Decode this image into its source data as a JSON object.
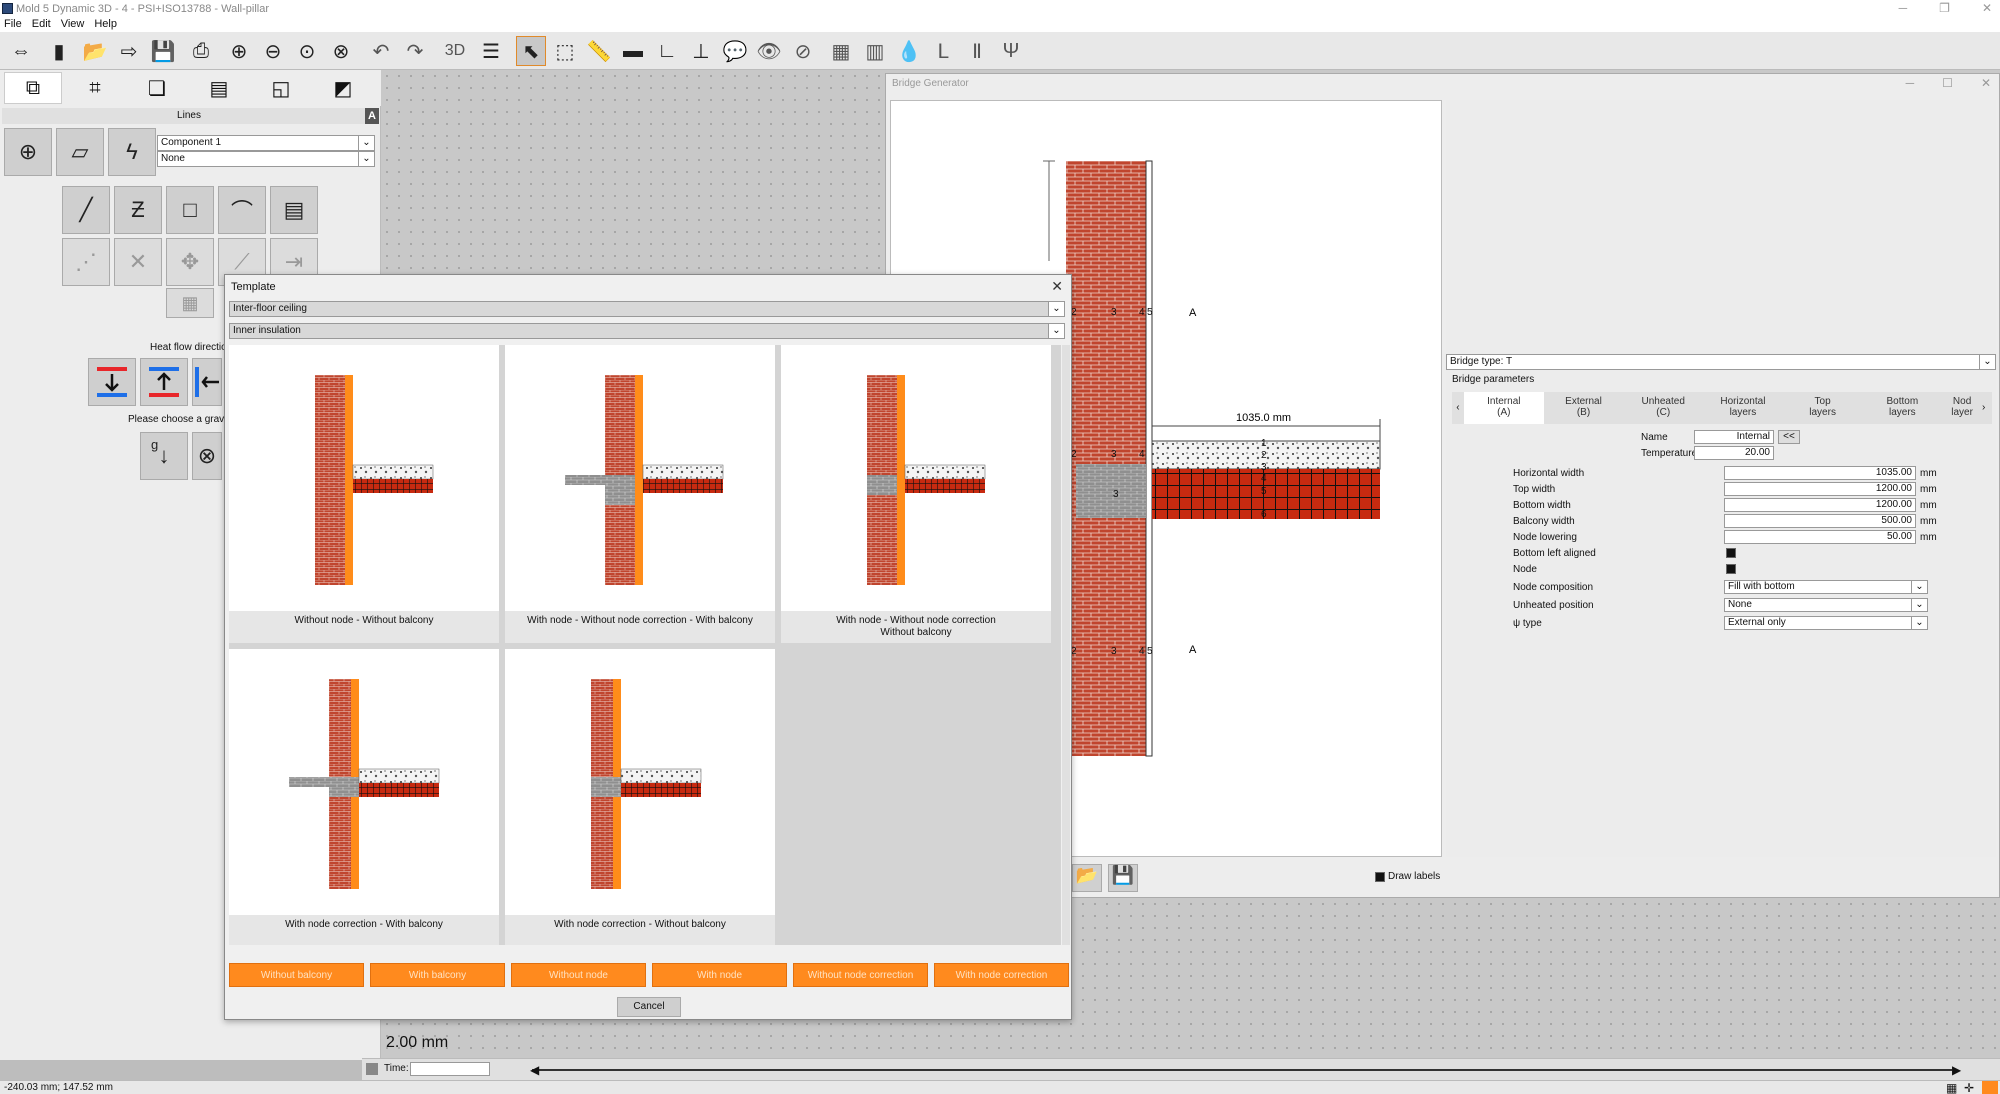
{
  "window": {
    "title": "Mold 5 Dynamic 3D - 4 - PSI+ISO13788 - Wall-pillar"
  },
  "menu": [
    "File",
    "Edit",
    "View",
    "Help"
  ],
  "toolbar": {
    "text_3d": "3D"
  },
  "left_panel": {
    "section_title": "Lines",
    "badge": "A",
    "component_select": "Component 1",
    "none_select": "None",
    "heat_flow_label": "Heat flow direction",
    "gravity_label": "Please choose a gravity",
    "gravity_g": "g"
  },
  "status": {
    "coords": "-240.03 mm; 147.52 mm",
    "scale_label": "2.00 mm",
    "time_label": "Time:"
  },
  "bridge": {
    "title": "Bridge Generator",
    "dimension_label": "1035.0 mm",
    "section_marker_a": "A",
    "layer_numbers": [
      "2",
      "3",
      "4",
      "5"
    ],
    "node_numbers": [
      "1",
      "2",
      "3",
      "4",
      "5",
      "6"
    ],
    "bridge_type": "Bridge type: T",
    "params_label": "Bridge parameters",
    "tabs": [
      {
        "line1": "Internal",
        "line2": "(A)"
      },
      {
        "line1": "External",
        "line2": "(B)"
      },
      {
        "line1": "Unheated",
        "line2": "(C)"
      },
      {
        "line1": "Horizontal",
        "line2": "layers"
      },
      {
        "line1": "Top",
        "line2": "layers"
      },
      {
        "line1": "Bottom",
        "line2": "layers"
      },
      {
        "line1": "Nod",
        "line2": "layer"
      }
    ],
    "name_label": "Name",
    "name_value": "Internal",
    "name_btn": "<<",
    "temp_label": "Temperature",
    "temp_value": "20.00",
    "fields": [
      {
        "label": "Horizontal width",
        "value": "1035.00",
        "unit": "mm"
      },
      {
        "label": "Top width",
        "value": "1200.00",
        "unit": "mm"
      },
      {
        "label": "Bottom width",
        "value": "1200.00",
        "unit": "mm"
      },
      {
        "label": "Balcony width",
        "value": "500.00",
        "unit": "mm"
      },
      {
        "label": "Node lowering",
        "value": "50.00",
        "unit": "mm"
      }
    ],
    "bottom_left_aligned": "Bottom left aligned",
    "node_label": "Node",
    "node_composition_label": "Node composition",
    "node_composition_value": "Fill with bottom",
    "unheated_position_label": "Unheated position",
    "unheated_position_value": "None",
    "psi_type_label": "ψ type",
    "psi_type_value": "External only",
    "draw_labels": "Draw labels"
  },
  "template": {
    "title": "Template",
    "select1": "Inter-floor ceiling",
    "select2": "Inner insulation",
    "cards": [
      {
        "line1": "Without node - Without balcony",
        "line2": ""
      },
      {
        "line1": "With node - Without node correction - With balcony",
        "line2": ""
      },
      {
        "line1": "With node - Without node correction",
        "line2": "Without balcony"
      },
      {
        "line1": "With node correction - With balcony",
        "line2": ""
      },
      {
        "line1": "With node correction - Without balcony",
        "line2": ""
      }
    ],
    "filters": [
      "Without balcony",
      "With balcony",
      "Without node",
      "With node",
      "Without node correction",
      "With node correction"
    ],
    "cancel": "Cancel"
  },
  "colors": {
    "accent_orange": "#ff8a1e",
    "brick": "#c0452e",
    "insulation": "#ff8c1a",
    "heat_red": "#e8262a",
    "heat_blue": "#1e6fe8"
  }
}
